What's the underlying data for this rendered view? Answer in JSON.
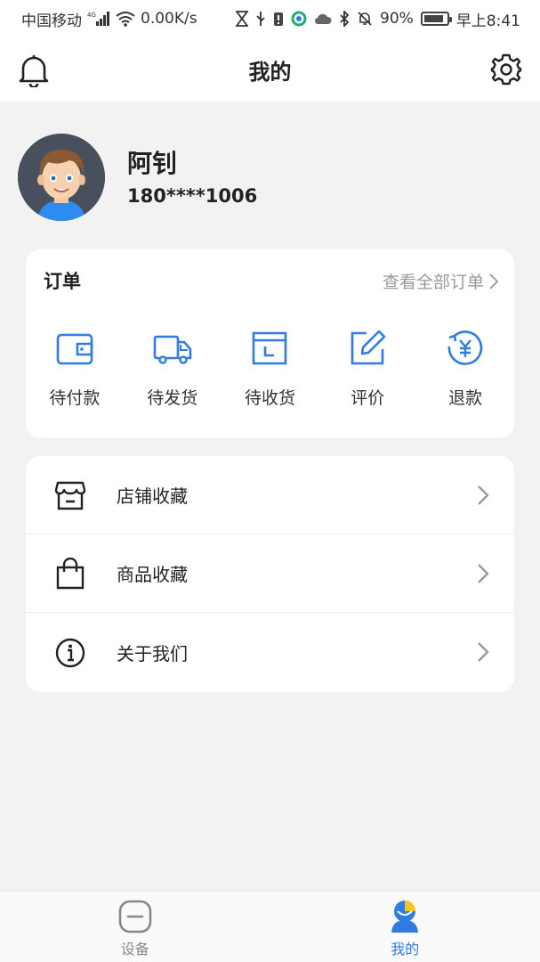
{
  "status_bar": {
    "carrier": "中国移动",
    "network": "4G",
    "speed": "0.00K/s",
    "battery": "90%",
    "battery_level": 0.9,
    "time": "早上8:41"
  },
  "header": {
    "title": "我的",
    "left_icon": "bell-icon",
    "right_icon": "gear-icon"
  },
  "profile": {
    "name": "阿钊",
    "phone": "180****1006"
  },
  "orders": {
    "title": "订单",
    "view_all": "查看全部订单",
    "items": [
      {
        "label": "待付款",
        "icon": "wallet-icon"
      },
      {
        "label": "待发货",
        "icon": "truck-icon"
      },
      {
        "label": "待收货",
        "icon": "package-icon"
      },
      {
        "label": "评价",
        "icon": "edit-icon"
      },
      {
        "label": "退款",
        "icon": "refund-icon"
      }
    ]
  },
  "menu": {
    "items": [
      {
        "label": "店铺收藏",
        "icon": "store-icon"
      },
      {
        "label": "商品收藏",
        "icon": "shopping-bag-icon"
      },
      {
        "label": "关于我们",
        "icon": "info-icon"
      }
    ]
  },
  "bottom_nav": {
    "tabs": [
      {
        "label": "设备",
        "icon": "device-icon",
        "active": false
      },
      {
        "label": "我的",
        "icon": "profile-icon",
        "active": true
      }
    ]
  },
  "colors": {
    "accent": "#2f7de1",
    "background": "#f2f2f2",
    "card": "#ffffff",
    "muted_text": "#9a9a9a"
  }
}
